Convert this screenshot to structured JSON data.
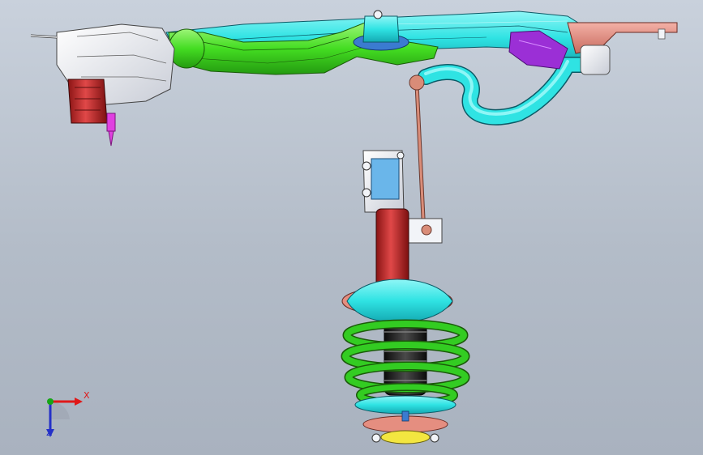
{
  "viewport": {
    "background_top": "#c9d1dc",
    "background_bottom": "#a9b2bf"
  },
  "model": {
    "parts": [
      {
        "name": "subframe",
        "color": "#2fe3e3"
      },
      {
        "name": "lower-control-arm",
        "color": "#44dd22"
      },
      {
        "name": "knuckle-housing",
        "color": "#f2f4f8"
      },
      {
        "name": "strut-tube",
        "color": "#c42a2a"
      },
      {
        "name": "coil-spring",
        "color": "#33cc22"
      },
      {
        "name": "stabilizer-link",
        "color": "#d98c78"
      },
      {
        "name": "stabilizer-bar",
        "color": "#2fe3e3"
      },
      {
        "name": "mount-bracket",
        "color": "#e58e80"
      },
      {
        "name": "purple-bracket",
        "color": "#9b2fd6"
      }
    ]
  },
  "triad": {
    "x_label": "X",
    "z_label": "Z",
    "x_color": "#e01818",
    "y_color": "#16a616",
    "z_color": "#2430c8"
  }
}
